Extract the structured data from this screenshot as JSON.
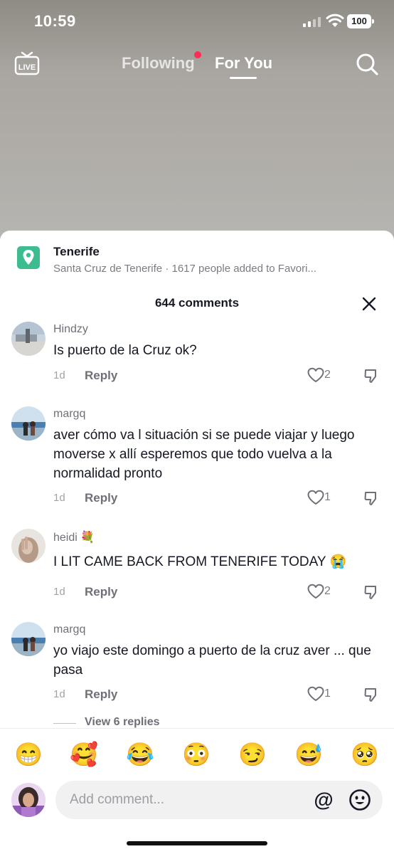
{
  "status_bar": {
    "time": "10:59",
    "battery": "100"
  },
  "top_nav": {
    "live_label": "LIVE",
    "tabs": [
      {
        "label": "Following",
        "has_dot": true
      },
      {
        "label": "For You",
        "active": true
      }
    ]
  },
  "location": {
    "title": "Tenerife",
    "subtitle": "Santa Cruz de Tenerife · 1617 people added to Favori..."
  },
  "comments_header": {
    "title": "644 comments"
  },
  "comments": [
    {
      "user": "Hindzy",
      "text": "Is puerto de la Cruz ok?",
      "time": "1d",
      "reply_label": "Reply",
      "likes": "2"
    },
    {
      "user": "margq",
      "text": "aver cómo va l situación si se puede viajar y luego moverse x allí esperemos que todo vuelva a la normalidad pronto",
      "time": "1d",
      "reply_label": "Reply",
      "likes": "1"
    },
    {
      "user": "heidi 💐",
      "text": "I LIT CAME BACK FROM TENERIFE TODAY 😭",
      "time": "1d",
      "reply_label": "Reply",
      "likes": "2"
    },
    {
      "user": "margq",
      "text": "yo viajo este domingo a puerto de la cruz aver ... que pasa",
      "time": "1d",
      "reply_label": "Reply",
      "likes": "1"
    }
  ],
  "view_replies": "View 6 replies",
  "emoji_bar": [
    "😁",
    "🥰",
    "😂",
    "😳",
    "😏",
    "😅",
    "🥺"
  ],
  "comment_input": {
    "placeholder": "Add comment...",
    "at_symbol": "@"
  },
  "colors": {
    "accent": "#fe2c55",
    "location_green": "#3cbc8f",
    "text_primary": "#161823",
    "text_secondary": "#6f7077"
  },
  "icons": [
    "live-icon",
    "search-icon",
    "location-pin-icon",
    "close-icon",
    "heart-icon",
    "dislike-icon",
    "at-icon",
    "emoji-icon"
  ]
}
